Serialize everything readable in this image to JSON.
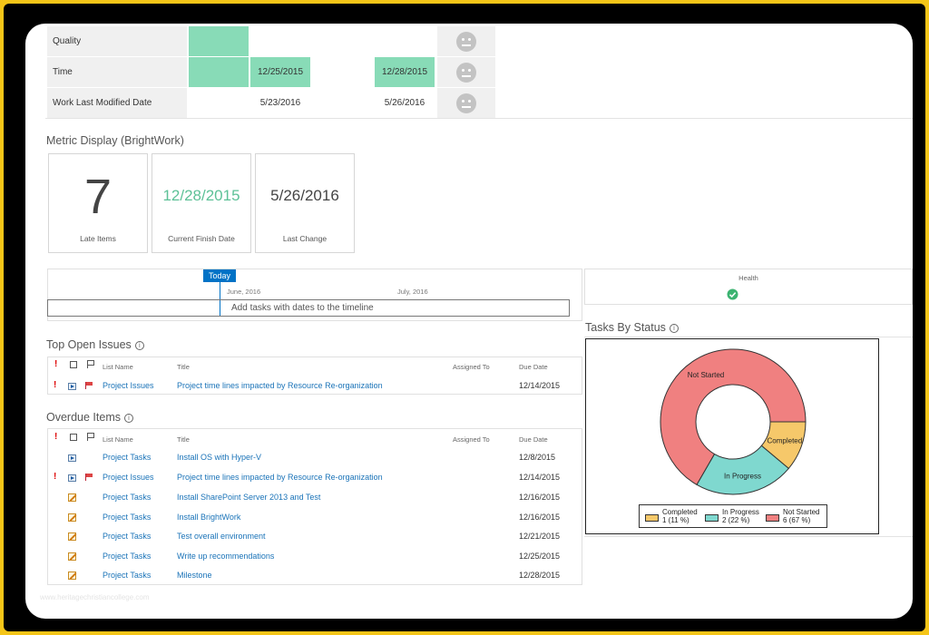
{
  "scorecard": {
    "rows": [
      {
        "label": "Quality",
        "c2": "",
        "c4": ""
      },
      {
        "label": "Time",
        "c2": "12/25/2015",
        "c4": "12/28/2015"
      },
      {
        "label": "Work Last Modified Date",
        "c2": "5/23/2016",
        "c4": "5/26/2016"
      }
    ]
  },
  "metrics": {
    "title": "Metric Display (BrightWork)",
    "tiles": [
      {
        "value": "7",
        "caption": "Late Items"
      },
      {
        "value": "12/28/2015",
        "caption": "Current Finish Date",
        "color": "#5dc197"
      },
      {
        "value": "5/26/2016",
        "caption": "Last Change"
      }
    ]
  },
  "timeline": {
    "today": "Today",
    "month1": "June, 2016",
    "month2": "July, 2016",
    "placeholder": "Add tasks with dates to the timeline"
  },
  "health": {
    "label": "Health",
    "status_icon": "check-circle-icon",
    "color": "#3cb371"
  },
  "columns": {
    "list": "List Name",
    "title": "Title",
    "assigned": "Assigned To",
    "due": "Due Date"
  },
  "top_issues": {
    "title": "Top Open Issues",
    "rows": [
      {
        "important": "!",
        "list": "Project Issues",
        "title": "Project time lines impacted by Resource Re-organization",
        "due": "12/14/2015"
      }
    ]
  },
  "overdue": {
    "title": "Overdue Items",
    "rows": [
      {
        "list": "Project Tasks",
        "title": "Install OS with Hyper-V",
        "due": "12/8/2015",
        "icon": "play"
      },
      {
        "important": "!",
        "list": "Project Issues",
        "title": "Project time lines impacted by Resource Re-organization",
        "due": "12/14/2015",
        "icon": "play",
        "flag": true
      },
      {
        "list": "Project Tasks",
        "title": "Install SharePoint Server 2013 and Test",
        "due": "12/16/2015",
        "icon": "task"
      },
      {
        "list": "Project Tasks",
        "title": "Install BrightWork",
        "due": "12/16/2015",
        "icon": "task"
      },
      {
        "list": "Project Tasks",
        "title": "Test overall environment",
        "due": "12/21/2015",
        "icon": "task"
      },
      {
        "list": "Project Tasks",
        "title": "Write up recommendations",
        "due": "12/25/2015",
        "icon": "task"
      },
      {
        "list": "Project Tasks",
        "title": "Milestone",
        "due": "12/28/2015",
        "icon": "task"
      }
    ]
  },
  "tasks_chart": {
    "title": "Tasks By Status",
    "colors": {
      "completed": "#f6c86a",
      "in_progress": "#7fd8cf",
      "not_started": "#f08080"
    },
    "legend": [
      {
        "name": "Completed",
        "detail": "1 (11 %)"
      },
      {
        "name": "In Progress",
        "detail": "2 (22 %)"
      },
      {
        "name": "Not Started",
        "detail": "6 (67 %)"
      }
    ]
  },
  "chart_data": {
    "type": "pie",
    "title": "",
    "categories": [
      "Completed",
      "In Progress",
      "Not Started"
    ],
    "values": [
      1,
      2,
      6
    ],
    "percent_labels": [
      "11 %",
      "22 %",
      "67 %"
    ],
    "donut": true,
    "legend": "bottom"
  },
  "watermark": "www.heritagechristiancollege.com"
}
